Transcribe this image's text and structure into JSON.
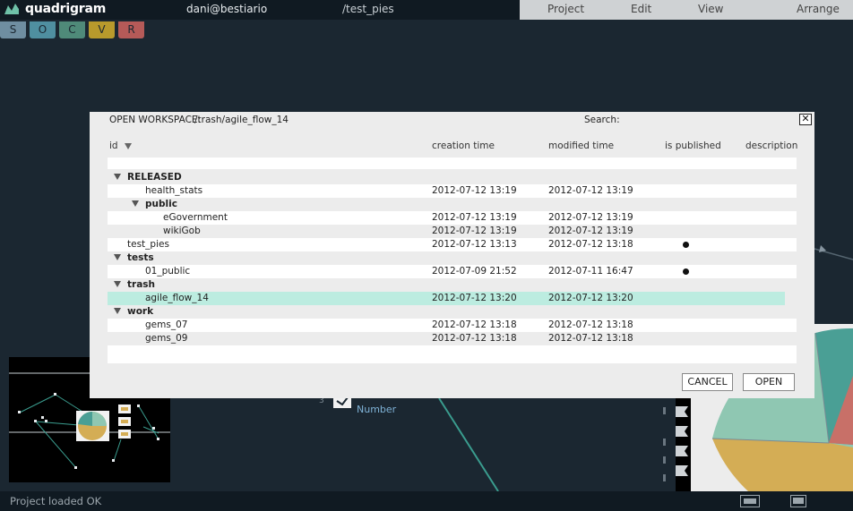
{
  "app": {
    "title": "quadrigram",
    "user": "dani@bestiario",
    "path": "/test_pies"
  },
  "menu": [
    "Project",
    "Edit",
    "View",
    "Arrange"
  ],
  "letter_buttons": [
    {
      "label": "S",
      "color": "#6f8ea1"
    },
    {
      "label": "O",
      "color": "#4f8fa0"
    },
    {
      "label": "C",
      "color": "#4f8a79"
    },
    {
      "label": "V",
      "color": "#b89a2c"
    },
    {
      "label": "R",
      "color": "#b55a58"
    }
  ],
  "canvas": {
    "node_number": "3",
    "node_label": "Number"
  },
  "status": "Project loaded OK",
  "dialog": {
    "title_label": "OPEN WORKSPACE:",
    "title_path": "/trash/agile_flow_14",
    "search_label": "Search:",
    "close_glyph": "✕",
    "columns": {
      "id": "id",
      "creation": "creation time",
      "modified": "modified time",
      "published": "is published",
      "description": "description"
    },
    "cancel": "CANCEL",
    "open": "OPEN",
    "rows": [
      {
        "name": "RELEASED",
        "level": 0,
        "group": true,
        "ctime": "",
        "mtime": "",
        "published": false
      },
      {
        "name": "health_stats",
        "level": 1,
        "group": false,
        "ctime": "2012-07-12 13:19",
        "mtime": "2012-07-12 13:19",
        "published": false
      },
      {
        "name": "public",
        "level": 1,
        "group": true,
        "ctime": "",
        "mtime": "",
        "published": false
      },
      {
        "name": "eGovernment",
        "level": 2,
        "group": false,
        "ctime": "2012-07-12 13:19",
        "mtime": "2012-07-12 13:19",
        "published": false
      },
      {
        "name": "wikiGob",
        "level": 2,
        "group": false,
        "ctime": "2012-07-12 13:19",
        "mtime": "2012-07-12 13:19",
        "published": false
      },
      {
        "name": "test_pies",
        "level": 0,
        "group": false,
        "ctime": "2012-07-12 13:13",
        "mtime": "2012-07-12 13:18",
        "published": true
      },
      {
        "name": "tests",
        "level": 0,
        "group": true,
        "ctime": "",
        "mtime": "",
        "published": false
      },
      {
        "name": "01_public",
        "level": 1,
        "group": false,
        "ctime": "2012-07-09 21:52",
        "mtime": "2012-07-11 16:47",
        "published": true
      },
      {
        "name": "trash",
        "level": 0,
        "group": true,
        "ctime": "",
        "mtime": "",
        "published": false
      },
      {
        "name": "agile_flow_14",
        "level": 1,
        "group": false,
        "ctime": "2012-07-12 13:20",
        "mtime": "2012-07-12 13:20",
        "published": false,
        "selected": true
      },
      {
        "name": "work",
        "level": 0,
        "group": true,
        "ctime": "",
        "mtime": "",
        "published": false
      },
      {
        "name": "gems_07",
        "level": 1,
        "group": false,
        "ctime": "2012-07-12 13:18",
        "mtime": "2012-07-12 13:18",
        "published": false
      },
      {
        "name": "gems_09",
        "level": 1,
        "group": false,
        "ctime": "2012-07-12 13:18",
        "mtime": "2012-07-12 13:18",
        "published": false
      }
    ]
  }
}
